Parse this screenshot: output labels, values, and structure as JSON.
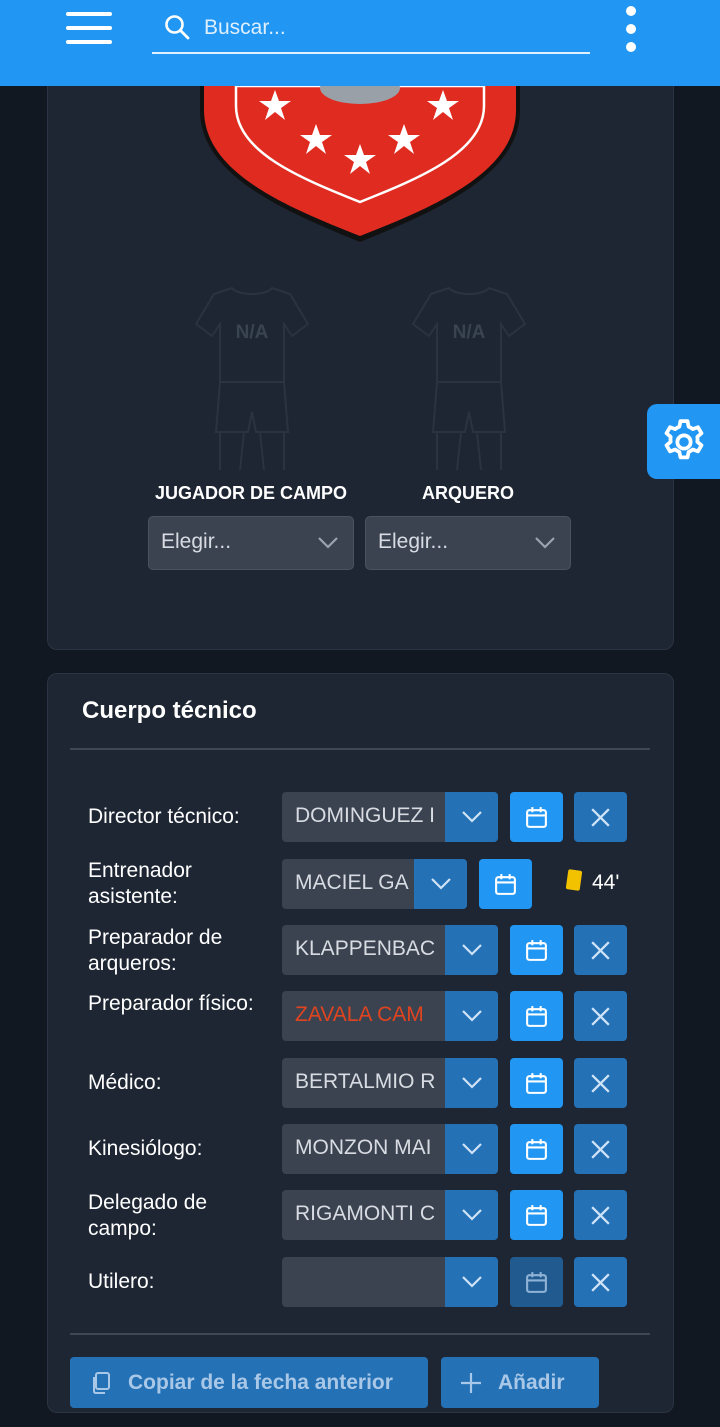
{
  "search": {
    "placeholder": "Buscar..."
  },
  "lineup": {
    "field_player": {
      "label": "JUGADOR DE CAMPO",
      "select_value": "Elegir...",
      "jersey_text": "N/A"
    },
    "goalkeeper": {
      "label": "ARQUERO",
      "select_value": "Elegir...",
      "jersey_text": "N/A"
    }
  },
  "staff": {
    "title": "Cuerpo técnico",
    "rows": [
      {
        "label": "Director técnico:",
        "value": "DOMINGUEZ I"
      },
      {
        "label": "Entrenador asistente:",
        "value": "MACIEL GA",
        "card_minute": "44'"
      },
      {
        "label": "Preparador de arqueros:",
        "value": "KLAPPENBAC"
      },
      {
        "label": "Preparador físico:",
        "value": "ZAVALA CAM"
      },
      {
        "label": "Médico:",
        "value": "BERTALMIO R"
      },
      {
        "label": "Kinesiólogo:",
        "value": "MONZON MAI"
      },
      {
        "label": "Delegado de campo:",
        "value": "RIGAMONTI C"
      },
      {
        "label": "Utilero:",
        "value": ""
      }
    ]
  },
  "actions": {
    "copy_label": "Copiar de la fecha anterior",
    "add_label": "Añadir"
  },
  "colors": {
    "topbar": "#2196f3",
    "card": "#1e2633",
    "crest_red": "#e02b20",
    "highlight_value": "#e0441f",
    "yellow_card": "#f2c200"
  },
  "icons": [
    "menu-icon",
    "search-icon",
    "more-vert-icon",
    "gear-icon",
    "chevron-down-icon",
    "calendar-icon",
    "close-icon",
    "copy-icon",
    "plus-icon"
  ]
}
